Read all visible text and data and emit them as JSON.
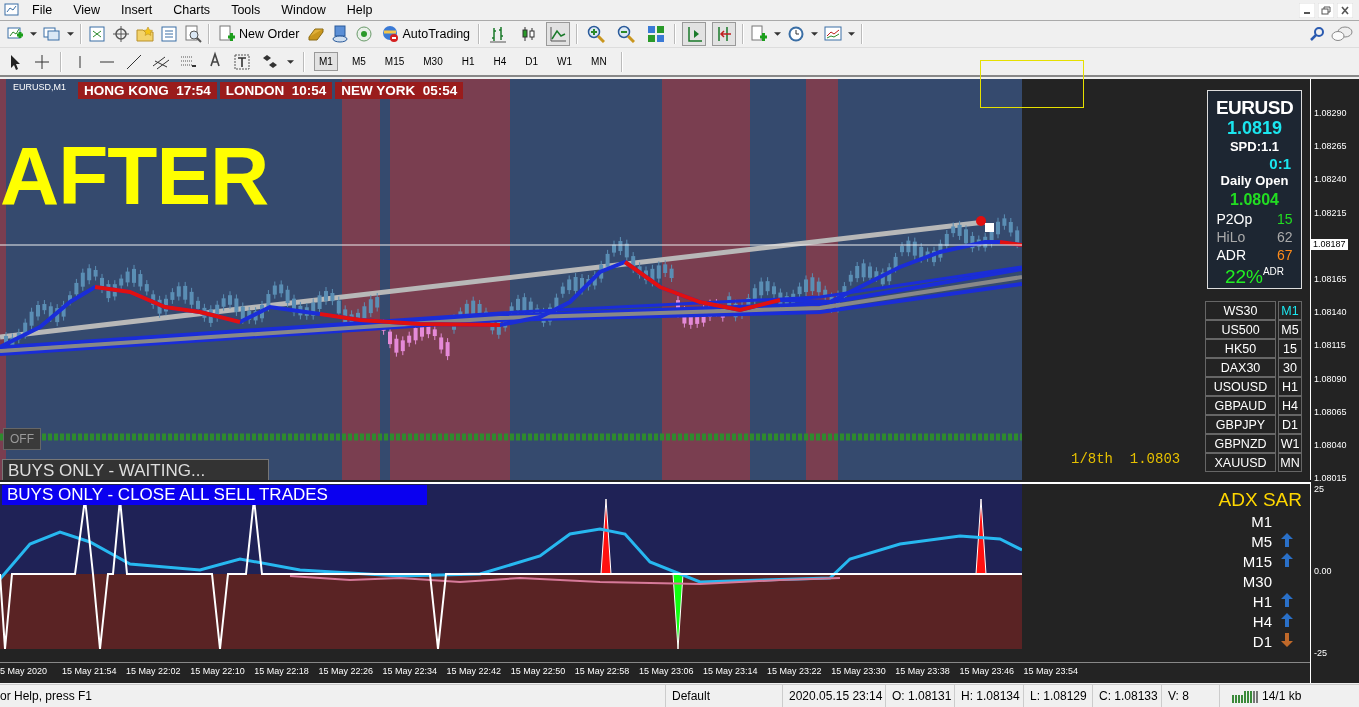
{
  "menu": [
    "File",
    "View",
    "Insert",
    "Charts",
    "Tools",
    "Window",
    "Help"
  ],
  "toolbar": {
    "new_order": "New Order",
    "auto_trading": "AutoTrading"
  },
  "timeframes": [
    {
      "label": "M1",
      "selected": true
    },
    {
      "label": "M5",
      "selected": false
    },
    {
      "label": "M15",
      "selected": false
    },
    {
      "label": "M30",
      "selected": false
    },
    {
      "label": "H1",
      "selected": false
    },
    {
      "label": "H4",
      "selected": false
    },
    {
      "label": "D1",
      "selected": false
    },
    {
      "label": "W1",
      "selected": false
    },
    {
      "label": "MN",
      "selected": false
    }
  ],
  "chart": {
    "symbol": "EURUSD,M1",
    "session_clocks": [
      {
        "city": "HONG KONG",
        "time": "17:54"
      },
      {
        "city": "LONDON",
        "time": "10:54"
      },
      {
        "city": "NEW YORK",
        "time": "05:54"
      }
    ],
    "overlay_title": "AFTER",
    "off_button": "OFF",
    "waiting_message": "BUYS ONLY - WAITING...",
    "signal_message": "BUYS ONLY - CLOSE ALL SELL TRADES",
    "level_label": "1/8th",
    "level_value": "1.0803",
    "price_ticks": [
      "1.08290",
      "1.08265",
      "1.08240",
      "1.08215",
      "1.08165",
      "1.08140",
      "1.08115",
      "1.08090",
      "1.08065",
      "1.08040",
      "1.08015"
    ],
    "current_price": "1.08187",
    "indicator_ticks": [
      "25",
      "0.00",
      "-25"
    ],
    "time_axis": [
      "5 May 2020",
      "15 May 21:54",
      "15 May 22:02",
      "15 May 22:10",
      "15 May 22:18",
      "15 May 22:26",
      "15 May 22:34",
      "15 May 22:42",
      "15 May 22:50",
      "15 May 22:58",
      "15 May 23:06",
      "15 May 23:14",
      "15 May 23:22",
      "15 May 23:30",
      "15 May 23:38",
      "15 May 23:46",
      "15 May 23:54"
    ]
  },
  "info_panel": {
    "symbol": "EURUSD",
    "bid": "1.0819",
    "spread": "SPD:1.1",
    "timer": "0:1",
    "daily_open_label": "Daily Open",
    "daily_open": "1.0804",
    "stats": [
      {
        "label": "P2Op",
        "value": "15",
        "color": "#22dd22"
      },
      {
        "label": "HiLo",
        "value": "62",
        "color": "#aaaaaa"
      },
      {
        "label": "ADR",
        "value": "67",
        "color": "#ff8c1a"
      }
    ],
    "adr_percent": "22%",
    "adr_suffix": "ADR"
  },
  "symbol_buttons": [
    {
      "symbol": "WS30",
      "timeframe": "M1",
      "selected": true
    },
    {
      "symbol": "US500",
      "timeframe": "M5",
      "selected": false
    },
    {
      "symbol": "HK50",
      "timeframe": "15",
      "selected": false
    },
    {
      "symbol": "DAX30",
      "timeframe": "30",
      "selected": false
    },
    {
      "symbol": "USOUSD",
      "timeframe": "H1",
      "selected": false
    },
    {
      "symbol": "GBPAUD",
      "timeframe": "H4",
      "selected": false
    },
    {
      "symbol": "GBPJPY",
      "timeframe": "D1",
      "selected": false
    },
    {
      "symbol": "GBPNZD",
      "timeframe": "W1",
      "selected": false
    },
    {
      "symbol": "XAUUSD",
      "timeframe": "MN",
      "selected": false
    }
  ],
  "adx_sar": {
    "title": "ADX SAR",
    "rows": [
      {
        "timeframe": "M1",
        "arrow_up": false,
        "arrow_down": false
      },
      {
        "timeframe": "M5",
        "arrow_up": true,
        "arrow_down": false
      },
      {
        "timeframe": "M15",
        "arrow_up": true,
        "arrow_down": false
      },
      {
        "timeframe": "M30",
        "arrow_up": false,
        "arrow_down": false
      },
      {
        "timeframe": "H1",
        "arrow_up": true,
        "arrow_down": false
      },
      {
        "timeframe": "H4",
        "arrow_up": true,
        "arrow_down": false
      },
      {
        "timeframe": "D1",
        "arrow_up": false,
        "arrow_down": true
      }
    ]
  },
  "status_bar": {
    "help": "or Help, press F1",
    "profile": "Default",
    "datetime": "2020.05.15 23:14",
    "open": "O: 1.08131",
    "high": "H: 1.08134",
    "low": "L: 1.08129",
    "close": "C: 1.08133",
    "volume": "V: 8",
    "traffic": "14/1 kb"
  }
}
